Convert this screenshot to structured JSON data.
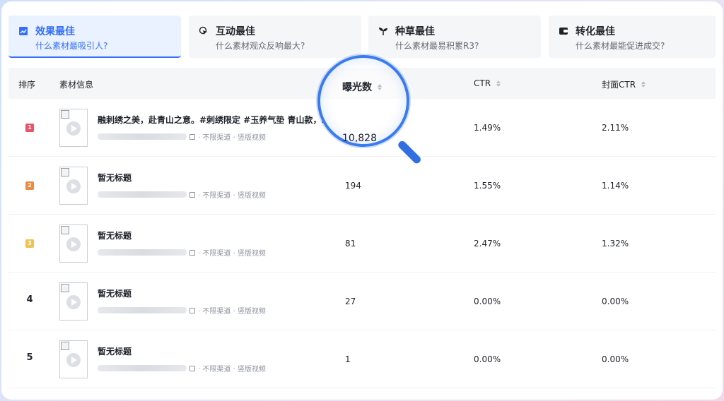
{
  "tabs": [
    {
      "title": "效果最佳",
      "subtitle": "什么素材最吸引人?",
      "icon": "chart-icon",
      "active": true
    },
    {
      "title": "互动最佳",
      "subtitle": "什么素材观众反响最大?",
      "icon": "cursor-click-icon",
      "active": false
    },
    {
      "title": "种草最佳",
      "subtitle": "什么素材最易积累R3?",
      "icon": "sprout-icon",
      "active": false
    },
    {
      "title": "转化最佳",
      "subtitle": "什么素材最能促进成交?",
      "icon": "wallet-icon",
      "active": false
    }
  ],
  "table": {
    "headers": {
      "rank": "排序",
      "material": "素材信息",
      "exposure": "曝光数",
      "ctr": "CTR",
      "cover_ctr": "封面CTR"
    },
    "rows": [
      {
        "rank": "1",
        "title": "融刺绣之美，赴青山之意。#刺绣限定 #玉养气垫 青山款，.",
        "channel": "· 不限渠道 · 竖版视频",
        "exposure": "10,828",
        "ctr": "1.49%",
        "cover_ctr": "2.11%"
      },
      {
        "rank": "2",
        "title": "暂无标题",
        "channel": "· 不限渠道 · 竖版视频",
        "exposure": "194",
        "ctr": "1.55%",
        "cover_ctr": "1.14%"
      },
      {
        "rank": "3",
        "title": "暂无标题",
        "channel": "· 不限渠道 · 竖版视频",
        "exposure": "81",
        "ctr": "2.47%",
        "cover_ctr": "1.32%"
      },
      {
        "rank": "4",
        "title": "暂无标题",
        "channel": "· 不限渠道 · 竖版视频",
        "exposure": "27",
        "ctr": "0.00%",
        "cover_ctr": "0.00%"
      },
      {
        "rank": "5",
        "title": "暂无标题",
        "channel": "· 不限渠道 · 竖版视频",
        "exposure": "1",
        "ctr": "0.00%",
        "cover_ctr": "0.00%"
      }
    ]
  },
  "colors": {
    "accent": "#3370ff",
    "rank1": "#e8536a",
    "rank2": "#f08a3c",
    "rank3": "#f2c14e",
    "magnifier": "#3a7bf0"
  }
}
